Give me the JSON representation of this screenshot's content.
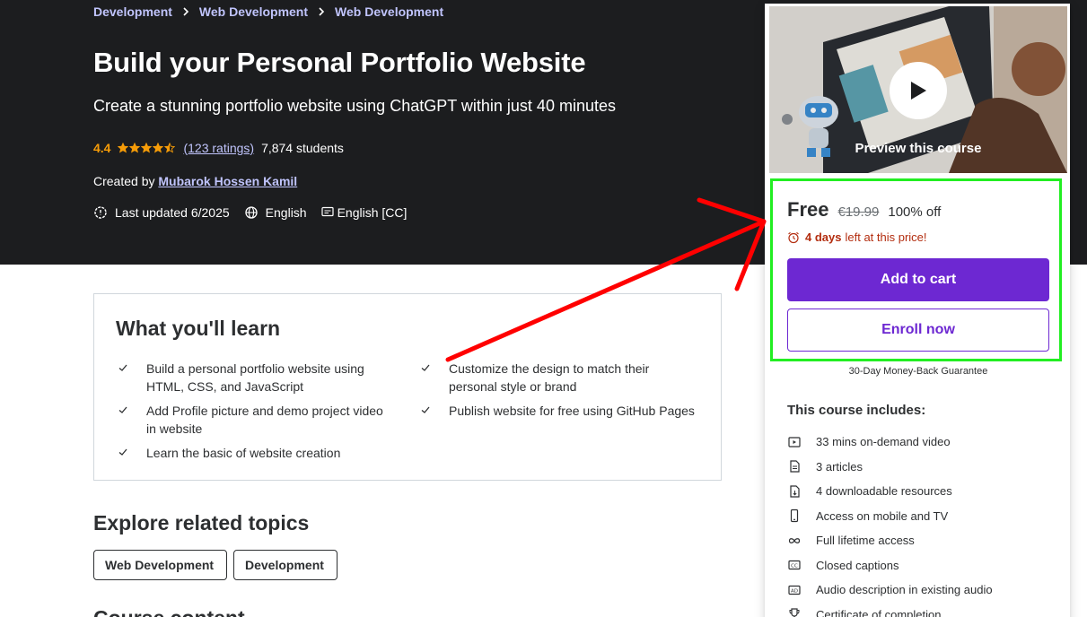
{
  "breadcrumb": [
    "Development",
    "Web Development",
    "Web Development"
  ],
  "course": {
    "title": "Build your Personal Portfolio Website",
    "subtitle": "Create a stunning portfolio website using ChatGPT within just 40 minutes",
    "rating": "4.4",
    "stars_filled": 4.5,
    "ratings_text": "(123 ratings)",
    "students": "7,874 students",
    "created_by_label": "Created by",
    "instructor": "Mubarok Hossen Kamil",
    "last_updated": "Last updated 6/2025",
    "language": "English",
    "captions": "English [CC]"
  },
  "learn": {
    "title": "What you'll learn",
    "items": [
      "Build a personal portfolio website using HTML, CSS, and JavaScript",
      "Customize the design to match their personal style or brand",
      "Add Profile picture and demo project video in website",
      "Publish website for free using GitHub Pages",
      "Learn the basic of website creation"
    ]
  },
  "explore": {
    "title": "Explore related topics",
    "topics": [
      "Web Development",
      "Development"
    ],
    "next_title": "Course content"
  },
  "sidebar": {
    "preview_caption": "Preview this course",
    "price": "Free",
    "old_price": "€19.99",
    "discount": "100% off",
    "deadline_bold": "4 days",
    "deadline_rest": "left at this price!",
    "add_to_cart": "Add to cart",
    "enroll_now": "Enroll now",
    "guarantee": "30-Day Money-Back Guarantee",
    "includes_title": "This course includes:",
    "includes": [
      {
        "icon": "video-icon",
        "label": "33 mins on-demand video"
      },
      {
        "icon": "article-icon",
        "label": "3 articles"
      },
      {
        "icon": "download-file-icon",
        "label": "4 downloadable resources"
      },
      {
        "icon": "mobile-icon",
        "label": "Access on mobile and TV"
      },
      {
        "icon": "infinity-icon",
        "label": "Full lifetime access"
      },
      {
        "icon": "closed-captions-icon",
        "label": "Closed captions"
      },
      {
        "icon": "audio-description-icon",
        "label": "Audio description in existing audio"
      },
      {
        "icon": "trophy-icon",
        "label": "Certificate of completion"
      }
    ]
  },
  "colors": {
    "hero_bg": "#1c1d1f",
    "link_purple": "#c0c4fc",
    "rating_orange": "#f69c08",
    "brand_purple": "#6d28d2",
    "deadline_red": "#b32d0f",
    "highlight_green": "#22ee22",
    "arrow_red": "#ff0000"
  }
}
